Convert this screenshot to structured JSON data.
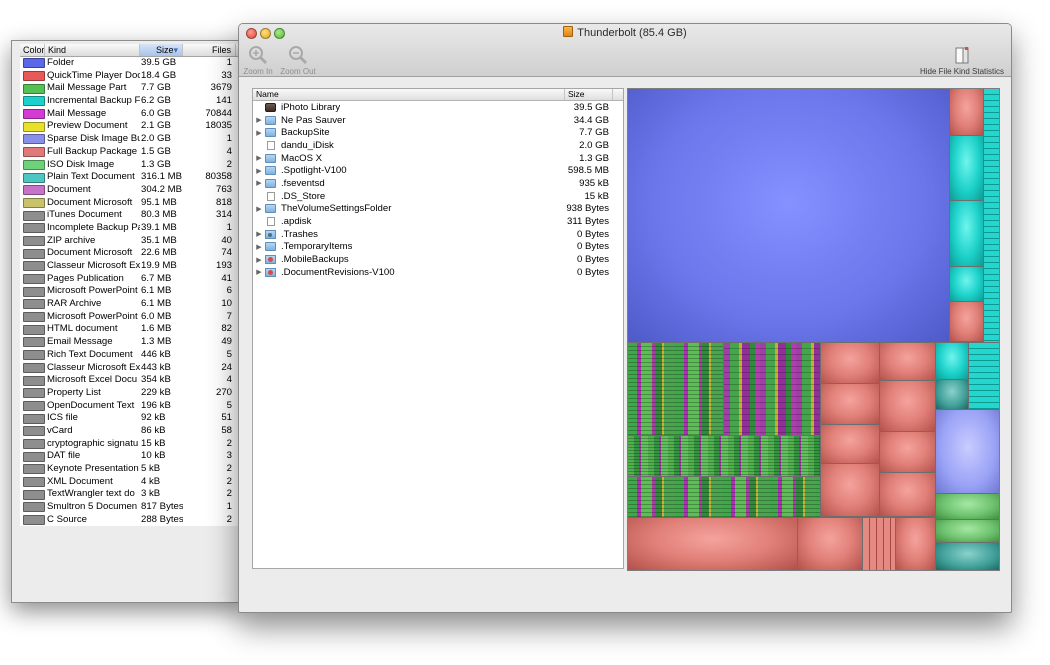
{
  "kind_stats": {
    "columns": {
      "color": "Color",
      "kind": "Kind",
      "size": "Size",
      "files": "Files"
    },
    "sort_indicator": "▾",
    "rows": [
      {
        "color": "#5a68e8",
        "kind": "Folder",
        "size": "39.5 GB",
        "files": "1"
      },
      {
        "color": "#e85a5a",
        "kind": "QuickTime Player Doc",
        "size": "18.4 GB",
        "files": "33"
      },
      {
        "color": "#55c155",
        "kind": "Mail Message Part",
        "size": "7.7 GB",
        "files": "3679"
      },
      {
        "color": "#1cd0cc",
        "kind": "Incremental Backup F",
        "size": "6.2 GB",
        "files": "141"
      },
      {
        "color": "#d43bd4",
        "kind": "Mail Message",
        "size": "6.0 GB",
        "files": "70844"
      },
      {
        "color": "#e8e02a",
        "kind": "Preview Document",
        "size": "2.1 GB",
        "files": "18035"
      },
      {
        "color": "#8a90e8",
        "kind": "Sparse Disk Image Bu",
        "size": "2.0 GB",
        "files": "1"
      },
      {
        "color": "#e07a7a",
        "kind": "Full Backup Package",
        "size": "1.5 GB",
        "files": "4"
      },
      {
        "color": "#6ed27a",
        "kind": "ISO Disk Image",
        "size": "1.3 GB",
        "files": "2"
      },
      {
        "color": "#4ec6c2",
        "kind": "Plain Text Document",
        "size": "316.1 MB",
        "files": "80358"
      },
      {
        "color": "#c773c7",
        "kind": "Document",
        "size": "304.2 MB",
        "files": "763"
      },
      {
        "color": "#c9c26a",
        "kind": "Document Microsoft",
        "size": "95.1 MB",
        "files": "818"
      },
      {
        "color": "#8e8e8e",
        "kind": "iTunes Document",
        "size": "80.3 MB",
        "files": "314"
      },
      {
        "color": "#8e8e8e",
        "kind": "Incomplete Backup Pa",
        "size": "39.1 MB",
        "files": "1"
      },
      {
        "color": "#8e8e8e",
        "kind": "ZIP archive",
        "size": "35.1 MB",
        "files": "40"
      },
      {
        "color": "#8e8e8e",
        "kind": "Document Microsoft",
        "size": "22.6 MB",
        "files": "74"
      },
      {
        "color": "#8e8e8e",
        "kind": "Classeur Microsoft Ex",
        "size": "19.9 MB",
        "files": "193"
      },
      {
        "color": "#8e8e8e",
        "kind": "Pages Publication",
        "size": "6.7 MB",
        "files": "41"
      },
      {
        "color": "#8e8e8e",
        "kind": "Microsoft PowerPoint",
        "size": "6.1 MB",
        "files": "6"
      },
      {
        "color": "#8e8e8e",
        "kind": "RAR Archive",
        "size": "6.1 MB",
        "files": "10"
      },
      {
        "color": "#8e8e8e",
        "kind": "Microsoft PowerPoint",
        "size": "6.0 MB",
        "files": "7"
      },
      {
        "color": "#8e8e8e",
        "kind": "HTML document",
        "size": "1.6 MB",
        "files": "82"
      },
      {
        "color": "#8e8e8e",
        "kind": "Email Message",
        "size": "1.3 MB",
        "files": "49"
      },
      {
        "color": "#8e8e8e",
        "kind": "Rich Text Document",
        "size": "446 kB",
        "files": "5"
      },
      {
        "color": "#8e8e8e",
        "kind": "Classeur Microsoft Ex",
        "size": "443 kB",
        "files": "24"
      },
      {
        "color": "#8e8e8e",
        "kind": "Microsoft Excel Docu",
        "size": "354 kB",
        "files": "4"
      },
      {
        "color": "#8e8e8e",
        "kind": "Property List",
        "size": "229 kB",
        "files": "270"
      },
      {
        "color": "#8e8e8e",
        "kind": "OpenDocument Text",
        "size": "196 kB",
        "files": "5"
      },
      {
        "color": "#8e8e8e",
        "kind": "ICS file",
        "size": "92 kB",
        "files": "51"
      },
      {
        "color": "#8e8e8e",
        "kind": "vCard",
        "size": "86 kB",
        "files": "58"
      },
      {
        "color": "#8e8e8e",
        "kind": "cryptographic signatu",
        "size": "15 kB",
        "files": "2"
      },
      {
        "color": "#8e8e8e",
        "kind": "DAT file",
        "size": "10 kB",
        "files": "3"
      },
      {
        "color": "#8e8e8e",
        "kind": "Keynote Presentation",
        "size": "5 kB",
        "files": "2"
      },
      {
        "color": "#8e8e8e",
        "kind": "XML Document",
        "size": "4 kB",
        "files": "2"
      },
      {
        "color": "#8e8e8e",
        "kind": "TextWrangler text do",
        "size": "3 kB",
        "files": "2"
      },
      {
        "color": "#8e8e8e",
        "kind": "Smultron 5 Documen",
        "size": "817 Bytes",
        "files": "1"
      },
      {
        "color": "#8e8e8e",
        "kind": "C Source",
        "size": "288 Bytes",
        "files": "2"
      }
    ]
  },
  "main": {
    "title": "Thunderbolt (85.4 GB)",
    "toolbar": {
      "zoom_in": "Zoom In",
      "zoom_out": "Zoom Out",
      "hide_stats": "Hide File Kind Statistics"
    },
    "file_list": {
      "columns": {
        "name": "Name",
        "size": "Size"
      },
      "rows": [
        {
          "name": "iPhoto Library",
          "size": "39.5 GB",
          "icon": "photo-library-icon",
          "expandable": false
        },
        {
          "name": "Ne Pas Sauver",
          "size": "34.4 GB",
          "icon": "folder-icon",
          "expandable": true
        },
        {
          "name": "BackupSite",
          "size": "7.7 GB",
          "icon": "folder-icon",
          "expandable": true
        },
        {
          "name": "dandu_iDisk",
          "size": "2.0 GB",
          "icon": "disk-image-icon",
          "expandable": false
        },
        {
          "name": "MacOS X",
          "size": "1.3 GB",
          "icon": "folder-icon",
          "expandable": true
        },
        {
          "name": ".Spotlight-V100",
          "size": "598.5 MB",
          "icon": "folder-icon",
          "expandable": true
        },
        {
          "name": ".fseventsd",
          "size": "935 kB",
          "icon": "folder-icon",
          "expandable": true
        },
        {
          "name": ".DS_Store",
          "size": "15 kB",
          "icon": "file-icon",
          "expandable": false
        },
        {
          "name": "TheVolumeSettingsFolder",
          "size": "938 Bytes",
          "icon": "folder-icon",
          "expandable": true
        },
        {
          "name": ".apdisk",
          "size": "311 Bytes",
          "icon": "file-icon",
          "expandable": false
        },
        {
          "name": ".Trashes",
          "size": "0 Bytes",
          "icon": "trash-folder-icon",
          "expandable": true
        },
        {
          "name": ".TemporaryItems",
          "size": "0 Bytes",
          "icon": "folder-icon",
          "expandable": true
        },
        {
          "name": ".MobileBackups",
          "size": "0 Bytes",
          "icon": "backup-folder-icon",
          "expandable": true
        },
        {
          "name": ".DocumentRevisions-V100",
          "size": "0 Bytes",
          "icon": "backup-folder-icon",
          "expandable": true
        }
      ]
    }
  }
}
